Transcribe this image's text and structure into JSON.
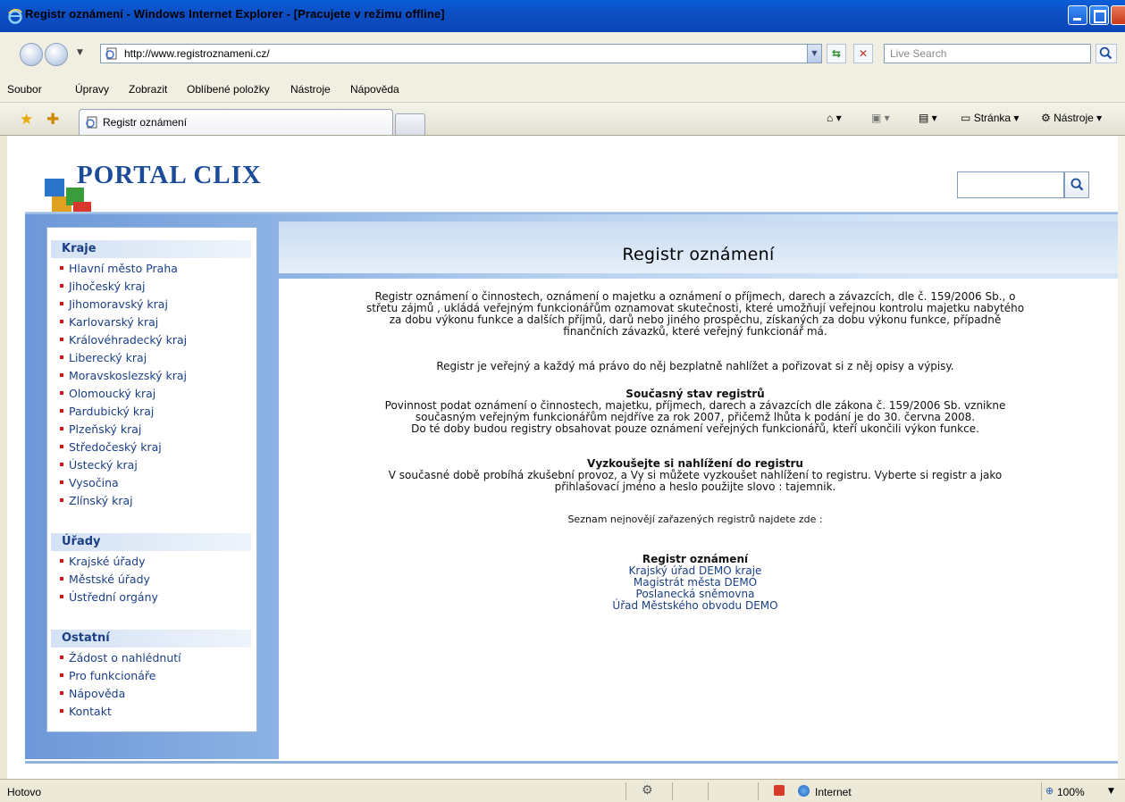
{
  "window": {
    "title": "Registr oznámení - Windows Internet Explorer - [Pracujete v režimu offline]"
  },
  "address": {
    "url": "http://www.registroznameni.cz/",
    "search_placeholder": "Live Search"
  },
  "menu": [
    "Soubor",
    "Úpravy",
    "Zobrazit",
    "Oblíbené položky",
    "Nástroje",
    "Nápověda"
  ],
  "tab": {
    "label": "Registr oznámení"
  },
  "toolbar": {
    "page_label": "Stránka",
    "tools_label": "Nástroje"
  },
  "portal": {
    "logo": "PORTAL CLIX"
  },
  "sidebar": {
    "sections": [
      {
        "title": "Kraje",
        "items": [
          "Hlavní město Praha",
          "Jihočeský kraj",
          "Jihomoravský kraj",
          "Karlovarský kraj",
          "Královéhradecký kraj",
          "Liberecký kraj",
          "Moravskoslezský kraj",
          "Olomoucký kraj",
          "Pardubický kraj",
          "Plzeňský kraj",
          "Středočeský kraj",
          "Ústecký kraj",
          "Vysočina",
          "Zlínský kraj"
        ]
      },
      {
        "title": "Úřady",
        "items": [
          "Krajské úřady",
          "Městské úřady",
          "Ústřední orgány"
        ]
      },
      {
        "title": "Ostatní",
        "items": [
          "Žádost o nahlédnutí",
          "Pro funkcionáře",
          "Nápověda",
          "Kontakt"
        ]
      }
    ]
  },
  "main": {
    "heading": "Registr oznámení",
    "intro_lines": [
      "Registr oznámení o činnostech, oznámení o majetku a oznámení o příjmech, darech a závazcích, dle č. 159/2006 Sb., o",
      "střetu zájmů , ukládá veřejným funkcionářům oznamovat skutečnosti, které umožňují veřejnou kontrolu majetku nabytého",
      "za dobu výkonu funkce a dalších příjmů, darů nebo jiného prospěchu, získaných za dobu výkonu funkce, případně",
      "finančních závazků, které veřejný funkcionář má."
    ],
    "public_line": "Registr je veřejný a každý má právo do něj bezplatně nahlížet a pořizovat si z něj opisy a výpisy.",
    "state_title": "Současný stav registrů",
    "state_lines": [
      "Povinnost podat oznámení o činnostech, majetku, příjmech, darech a závazcích dle zákona č. 159/2006 Sb. vznikne",
      "současným veřejným funkcionářům nejdříve za rok 2007, přičemž lhůta k podání je do 30. června 2008.",
      "Do té doby budou registry obsahovat pouze oznámení veřejných funkcionářů, kteří ukončili výkon funkce."
    ],
    "try_title": "Vyzkoušejte si nahlížení do registru",
    "try_lines": [
      "V současné době probíhá zkušební provoz, a Vy si můžete vyzkoušet nahlížení to registru. Vyberte si registr a jako",
      "přihlašovací jméno a heslo použijte slovo : tajemnik."
    ],
    "list_line": "Seznam nejnovějí zařazených registrů najdete zde :",
    "registry_title": "Registr oznámení",
    "registry_links": [
      "Krajský úřad DEMO kraje",
      "Magistrát města DEMO",
      "Poslanecká sněmovna",
      "Úřad Městského obvodu DEMO"
    ]
  },
  "status": {
    "text": "Hotovo",
    "zone": "Internet",
    "zoom": "100%"
  },
  "colors": {
    "titlebar": "#0c4fc4",
    "link": "#1a3f85",
    "bullet": "#d41414",
    "content_bg": "#8fb4e4"
  }
}
